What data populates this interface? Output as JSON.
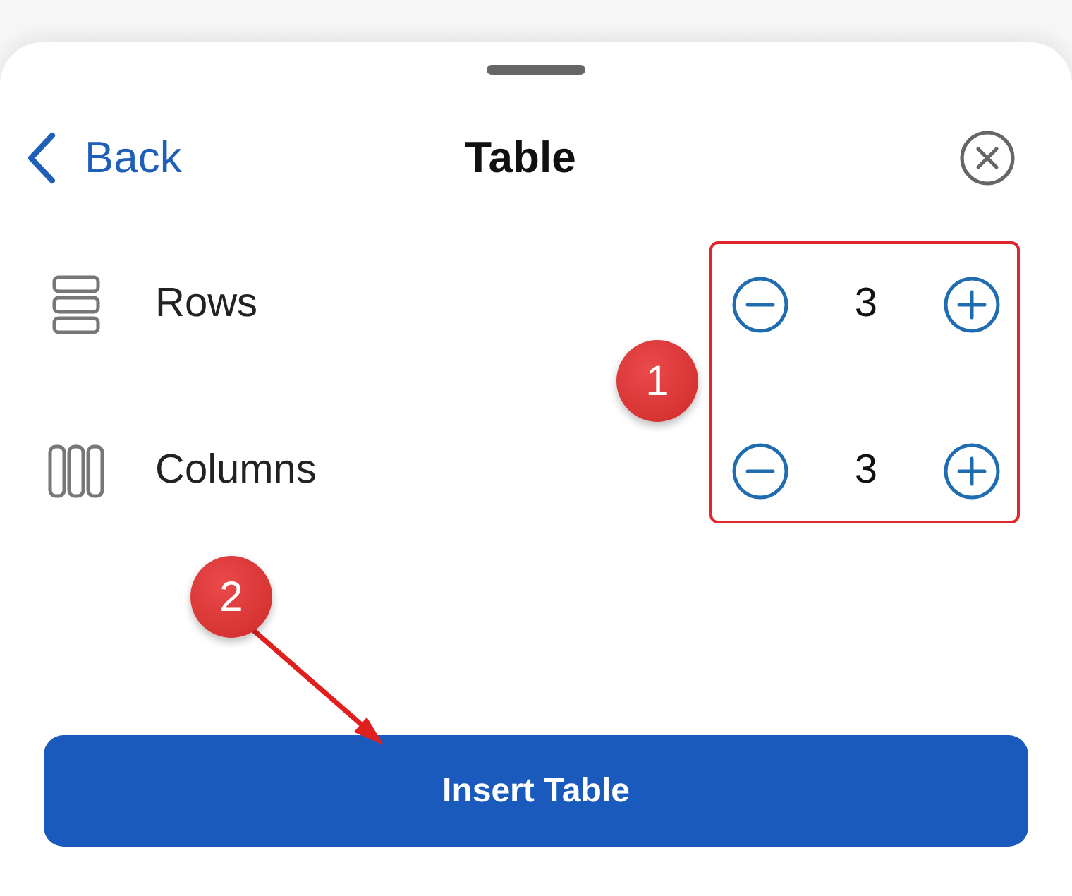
{
  "header": {
    "back_label": "Back",
    "title": "Table"
  },
  "settings": [
    {
      "kind": "rows",
      "label": "Rows",
      "value": "3"
    },
    {
      "kind": "columns",
      "label": "Columns",
      "value": "3"
    }
  ],
  "primary_button": {
    "label": "Insert Table"
  },
  "annotations": [
    {
      "kind": "frame",
      "label": "1"
    },
    {
      "kind": "arrow",
      "label": "2"
    }
  ]
}
